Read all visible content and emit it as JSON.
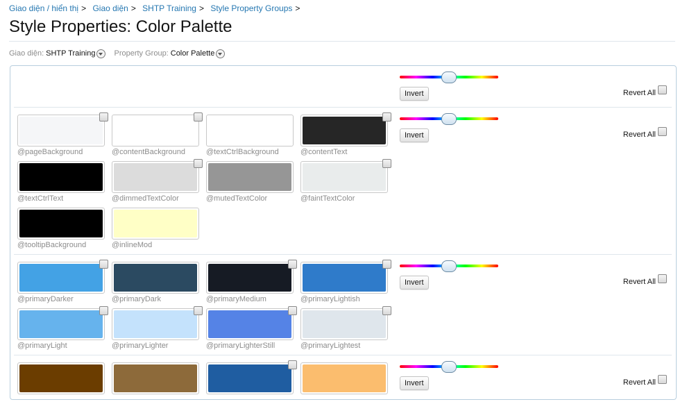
{
  "breadcrumb": [
    "Giao diện / hiển thị",
    "Giao diện",
    "SHTP Training",
    "Style Property Groups"
  ],
  "page_title": "Style Properties: Color Palette",
  "filters": {
    "style_label": "Giao diện:",
    "style_value": "SHTP Training",
    "group_label": "Property Group:",
    "group_value": "Color Palette"
  },
  "controls": {
    "invert_label": "Invert",
    "revert_label": "Revert All"
  },
  "groups": [
    {
      "swatches": []
    },
    {
      "swatches": [
        {
          "name": "@pageBackground",
          "color": "#f5f6f8",
          "checkbox": true
        },
        {
          "name": "@contentBackground",
          "color": "#ffffff",
          "checkbox": true
        },
        {
          "name": "@textCtrlBackground",
          "color": "#ffffff",
          "checkbox": false
        },
        {
          "name": "@contentText",
          "color": "#262626",
          "checkbox": true
        },
        {
          "name": "@textCtrlText",
          "color": "#000000",
          "checkbox": false
        },
        {
          "name": "@dimmedTextColor",
          "color": "#dcdcdc",
          "checkbox": true
        },
        {
          "name": "@mutedTextColor",
          "color": "#969696",
          "checkbox": false
        },
        {
          "name": "@faintTextColor",
          "color": "#e9ecec",
          "checkbox": true
        },
        {
          "name": "@tooltipBackground",
          "color": "#000000",
          "checkbox": false
        },
        {
          "name": "@inlineMod",
          "color": "#ffffc6",
          "checkbox": false
        }
      ]
    },
    {
      "swatches": [
        {
          "name": "@primaryDarker",
          "color": "#43a2e5",
          "checkbox": true
        },
        {
          "name": "@primaryDark",
          "color": "#2b4a61",
          "checkbox": false
        },
        {
          "name": "@primaryMedium",
          "color": "#161b24",
          "checkbox": true
        },
        {
          "name": "@primaryLightish",
          "color": "#2f7bca",
          "checkbox": true
        },
        {
          "name": "@primaryLight",
          "color": "#66b3ed",
          "checkbox": true
        },
        {
          "name": "@primaryLighter",
          "color": "#c4e2fc",
          "checkbox": true
        },
        {
          "name": "@primaryLighterStill",
          "color": "#5583e6",
          "checkbox": true
        },
        {
          "name": "@primaryLightest",
          "color": "#dfe6ec",
          "checkbox": true
        }
      ]
    },
    {
      "swatches": [
        {
          "name": "",
          "color": "#6b3d00",
          "checkbox": false
        },
        {
          "name": "",
          "color": "#8d6a3a",
          "checkbox": false
        },
        {
          "name": "",
          "color": "#1f5da1",
          "checkbox": true
        },
        {
          "name": "",
          "color": "#fbbd6e",
          "checkbox": false
        }
      ]
    }
  ]
}
